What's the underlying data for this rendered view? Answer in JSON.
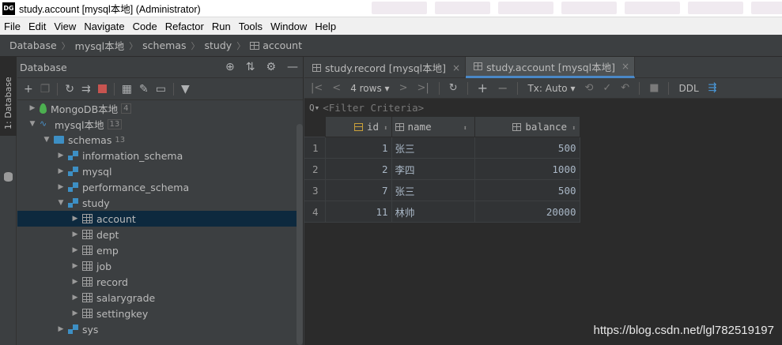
{
  "window": {
    "logo": "DG",
    "title": "study.account [mysql本地] (Administrator)"
  },
  "menu": [
    "File",
    "Edit",
    "View",
    "Navigate",
    "Code",
    "Refactor",
    "Run",
    "Tools",
    "Window",
    "Help"
  ],
  "breadcrumb": [
    "Database",
    "mysql本地",
    "schemas",
    "study",
    "account"
  ],
  "stripe": {
    "label": "1: Database"
  },
  "db_panel": {
    "title": "Database",
    "tree": [
      {
        "label": "MongoDB本地",
        "badge": "4",
        "icon": "mongodb-leaf-icon",
        "depth": 0,
        "arrow": "▶"
      },
      {
        "label": "mysql本地",
        "badge": "13",
        "icon": "mysql-dolphin-icon",
        "depth": 0,
        "arrow": "▼"
      },
      {
        "label": "schemas",
        "badge": "13",
        "icon": "folder-icon",
        "depth": 1,
        "arrow": "▼"
      },
      {
        "label": "information_schema",
        "badge": "",
        "icon": "schema-icon",
        "depth": 2,
        "arrow": "▶"
      },
      {
        "label": "mysql",
        "badge": "",
        "icon": "schema-icon",
        "depth": 2,
        "arrow": "▶"
      },
      {
        "label": "performance_schema",
        "badge": "",
        "icon": "schema-icon",
        "depth": 2,
        "arrow": "▶"
      },
      {
        "label": "study",
        "badge": "",
        "icon": "schema-icon",
        "depth": 2,
        "arrow": "▼"
      },
      {
        "label": "account",
        "badge": "",
        "icon": "table-icon",
        "depth": 3,
        "arrow": "▶",
        "selected": true
      },
      {
        "label": "dept",
        "badge": "",
        "icon": "table-icon",
        "depth": 3,
        "arrow": "▶"
      },
      {
        "label": "emp",
        "badge": "",
        "icon": "table-icon",
        "depth": 3,
        "arrow": "▶"
      },
      {
        "label": "job",
        "badge": "",
        "icon": "table-icon",
        "depth": 3,
        "arrow": "▶"
      },
      {
        "label": "record",
        "badge": "",
        "icon": "table-icon",
        "depth": 3,
        "arrow": "▶"
      },
      {
        "label": "salarygrade",
        "badge": "",
        "icon": "table-icon",
        "depth": 3,
        "arrow": "▶"
      },
      {
        "label": "settingkey",
        "badge": "",
        "icon": "table-icon",
        "depth": 3,
        "arrow": "▶"
      },
      {
        "label": "sys",
        "badge": "",
        "icon": "schema-icon",
        "depth": 2,
        "arrow": "▶"
      }
    ]
  },
  "tabs": [
    {
      "label": "study.record [mysql本地]",
      "active": false
    },
    {
      "label": "study.account [mysql本地]",
      "active": true
    }
  ],
  "editor_toolbar": {
    "rows": "4 rows",
    "tx": "Tx: Auto",
    "ddl": "DDL"
  },
  "filter": {
    "placeholder": "<Filter Criteria>"
  },
  "grid": {
    "columns": [
      "id",
      "name",
      "balance"
    ],
    "rows": [
      {
        "num": "1",
        "id": "1",
        "name": "张三",
        "balance": "500"
      },
      {
        "num": "2",
        "id": "2",
        "name": "李四",
        "balance": "1000"
      },
      {
        "num": "3",
        "id": "7",
        "name": "张三",
        "balance": "500"
      },
      {
        "num": "4",
        "id": "11",
        "name": "林帅",
        "balance": "20000"
      }
    ]
  },
  "watermark": "https://blog.csdn.net/lgl782519197",
  "colors": {
    "selection": "#0d293e",
    "accent": "#4a88c7",
    "stop_red": "#c75450"
  }
}
